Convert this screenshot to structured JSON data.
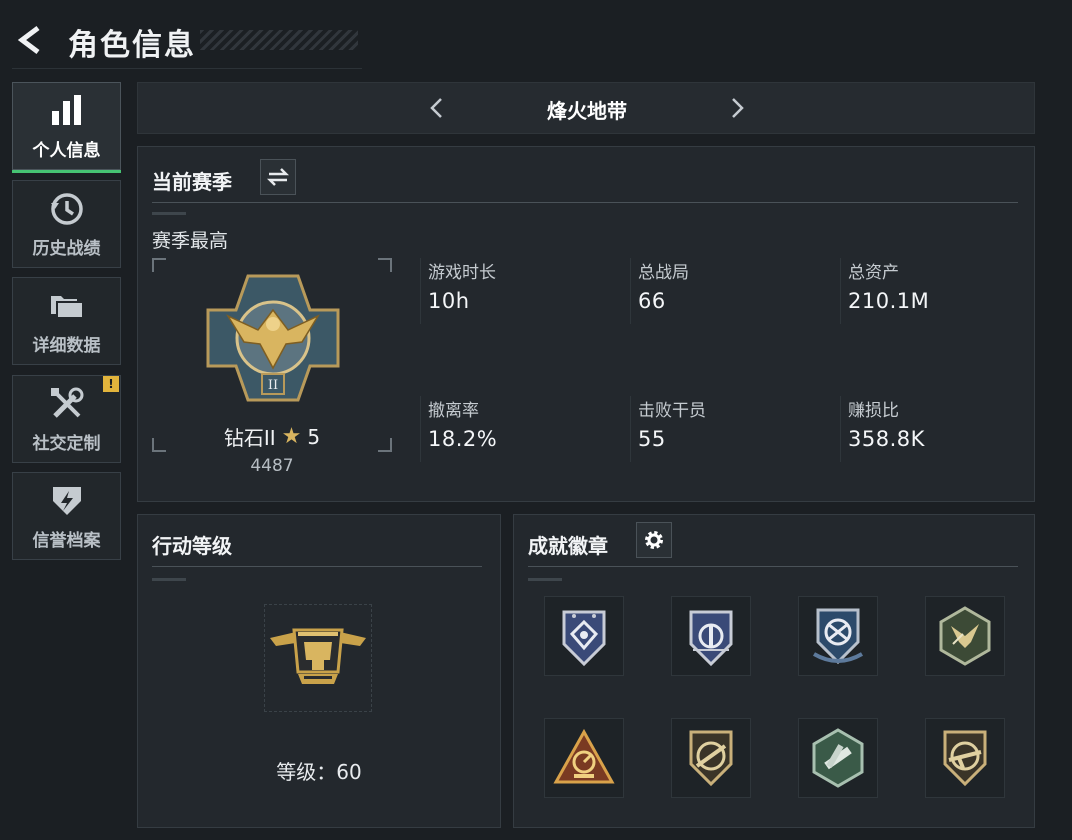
{
  "header": {
    "title": "角色信息",
    "back_icon": "back-arrow-icon"
  },
  "sidebar": {
    "items": [
      {
        "label": "个人信息",
        "icon": "bar-chart-icon",
        "active": true
      },
      {
        "label": "历史战绩",
        "icon": "history-clock-icon",
        "active": false
      },
      {
        "label": "详细数据",
        "icon": "folder-icon",
        "active": false
      },
      {
        "label": "社交定制",
        "icon": "tools-icon",
        "active": false,
        "alert": "!"
      },
      {
        "label": "信誉档案",
        "icon": "shield-bolt-icon",
        "active": false
      }
    ]
  },
  "mode": {
    "title": "烽火地带",
    "prev_icon": "chevron-left-icon",
    "next_icon": "chevron-right-icon"
  },
  "season": {
    "title": "当前赛季",
    "switch_icon": "swap-icon",
    "best_label": "赛季最高",
    "rank": {
      "name": "钻石II",
      "stars": "5",
      "points": "4487",
      "icon": "diamond-eagle-rank-emblem"
    },
    "stats": [
      {
        "label": "游戏时长",
        "value": "10h"
      },
      {
        "label": "总战局",
        "value": "66"
      },
      {
        "label": "总资产",
        "value": "210.1M"
      },
      {
        "label": "撤离率",
        "value": "18.2%"
      },
      {
        "label": "击败干员",
        "value": "55"
      },
      {
        "label": "赚损比",
        "value": "358.8K"
      }
    ]
  },
  "operation": {
    "title": "行动等级",
    "level_label": "等级：",
    "level_value": "60",
    "icon": "helicopter-emblem"
  },
  "achievements": {
    "title": "成就徽章",
    "settings_icon": "gear-icon",
    "badges": [
      "shield-badge-silver-1",
      "shield-badge-silver-2",
      "shield-badge-blue-arrows",
      "hexagon-badge-green-bird",
      "triangle-badge-orange-radar",
      "shield-badge-rifle-1",
      "hexagon-badge-green-weapons",
      "shield-badge-rifle-2"
    ]
  },
  "colors": {
    "background": "#1b1f23",
    "panel": "#23282d",
    "accent_green": "#46c373",
    "alert_yellow": "#e2b43c",
    "gold": "#c9a24a"
  }
}
